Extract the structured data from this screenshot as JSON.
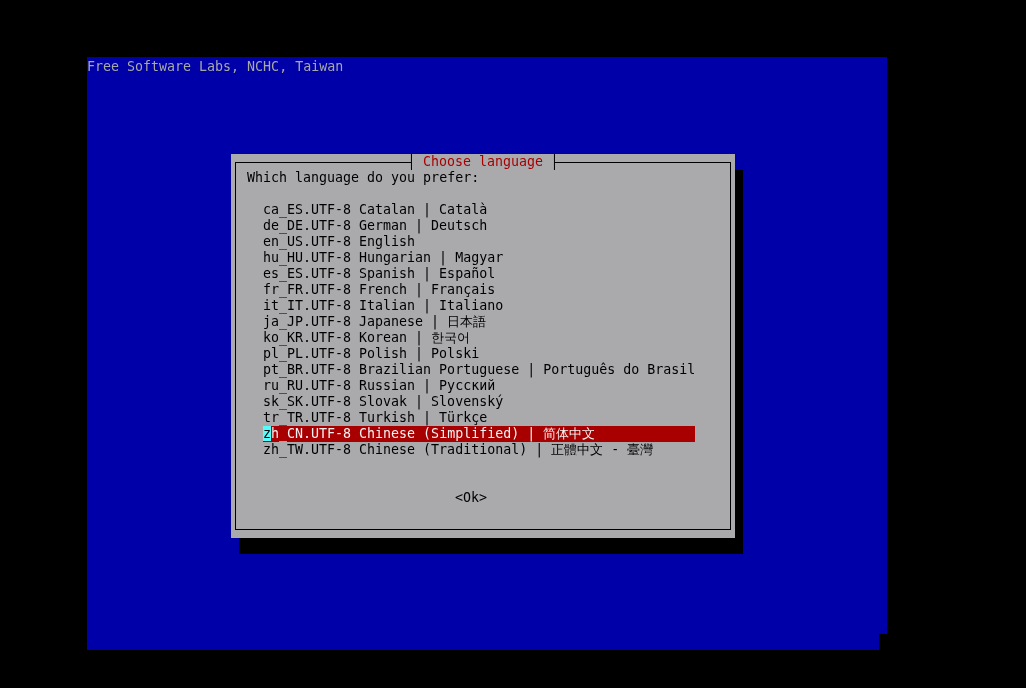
{
  "backtitle": "Free Software Labs, NCHC, Taiwan",
  "dialog": {
    "title": "Choose language",
    "prompt": "Which language do you prefer:",
    "items": [
      {
        "label": "ca_ES.UTF-8 Catalan | Català",
        "selected": false
      },
      {
        "label": "de_DE.UTF-8 German | Deutsch",
        "selected": false
      },
      {
        "label": "en_US.UTF-8 English",
        "selected": false
      },
      {
        "label": "hu_HU.UTF-8 Hungarian | Magyar",
        "selected": false
      },
      {
        "label": "es_ES.UTF-8 Spanish | Español",
        "selected": false
      },
      {
        "label": "fr_FR.UTF-8 French | Français",
        "selected": false
      },
      {
        "label": "it_IT.UTF-8 Italian | Italiano",
        "selected": false
      },
      {
        "label": "ja_JP.UTF-8 Japanese | 日本語",
        "selected": false
      },
      {
        "label": "ko_KR.UTF-8 Korean | 한국어",
        "selected": false
      },
      {
        "label": "pl_PL.UTF-8 Polish | Polski",
        "selected": false
      },
      {
        "label": "pt_BR.UTF-8 Brazilian Portuguese | Português do Brasil",
        "selected": false
      },
      {
        "label": "ru_RU.UTF-8 Russian | Русский",
        "selected": false
      },
      {
        "label": "sk_SK.UTF-8 Slovak | Slovenský",
        "selected": false
      },
      {
        "label": "tr_TR.UTF-8 Turkish | Türkçe",
        "selected": false
      },
      {
        "label": "zh_CN.UTF-8 Chinese (Simplified) | 简体中文",
        "selected": true
      },
      {
        "label": "zh_TW.UTF-8 Chinese (Traditional) | 正體中文 - 臺灣",
        "selected": false
      }
    ],
    "buttons": [
      {
        "label": "<Ok>"
      }
    ]
  }
}
